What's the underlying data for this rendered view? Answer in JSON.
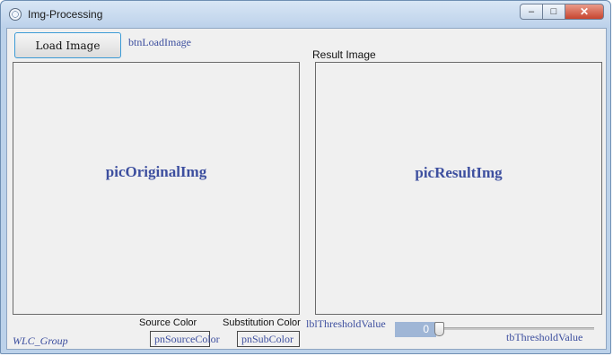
{
  "window": {
    "title": "Img-Processing",
    "controls": {
      "minimize": "–",
      "maximize": "□",
      "close": "✕"
    }
  },
  "toolbar": {
    "load_button_label": "Load Image",
    "load_button_name": "btnLoadImage"
  },
  "original_panel": {
    "name": "picOriginalImg"
  },
  "result_panel": {
    "caption": "Result Image",
    "name": "picResultImg"
  },
  "bottom": {
    "group_name": "WLC_Group",
    "source_color": {
      "label": "Source Color",
      "box_name": "pnSourceColor"
    },
    "substitution_color": {
      "label": "Substitution Color",
      "box_name": "pnSubColor"
    },
    "threshold": {
      "label_name": "lblThresholdValue",
      "value": "0",
      "trackbar_name": "tbThresholdValue"
    }
  },
  "colors": {
    "accent_label": "#3d4f9f",
    "threshold_value_bg": "#9fb6d6",
    "button_focus_border": "#3c9bd6"
  }
}
